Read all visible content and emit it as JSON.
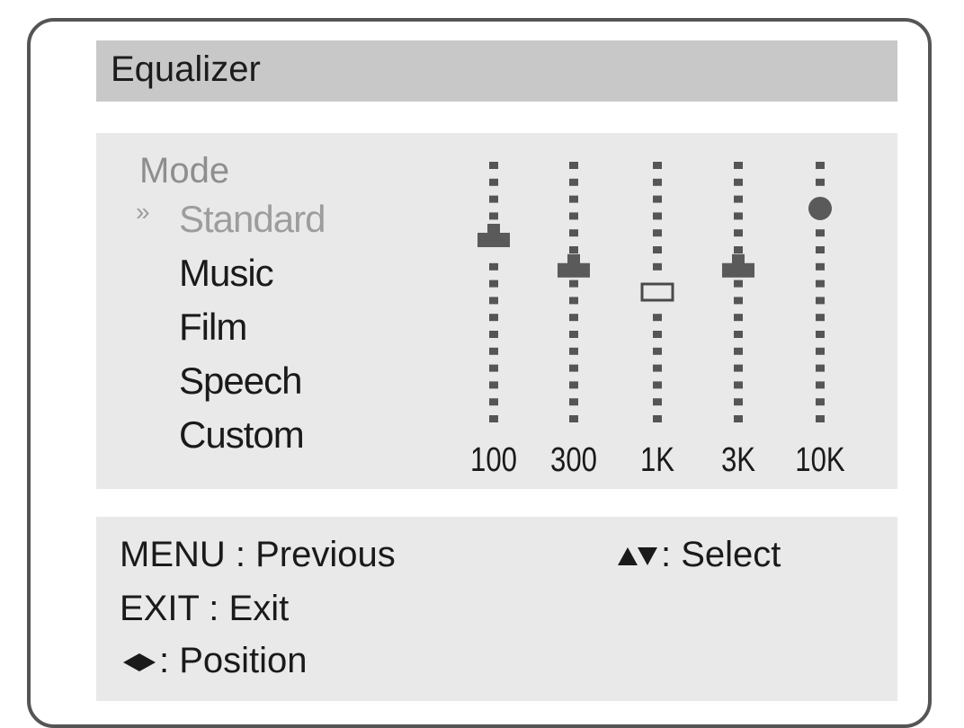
{
  "title": "Equalizer",
  "mode": {
    "heading": "Mode",
    "selected_marker": "»",
    "items": [
      {
        "label": "Standard",
        "selected": true
      },
      {
        "label": "Music",
        "selected": false
      },
      {
        "label": "Film",
        "selected": false
      },
      {
        "label": "Speech",
        "selected": false
      },
      {
        "label": "Custom",
        "selected": false
      }
    ]
  },
  "equalizer": {
    "bands": [
      {
        "label": "100",
        "level": 0.72,
        "handle": "filled"
      },
      {
        "label": "300",
        "level": 0.6,
        "handle": "filled"
      },
      {
        "label": "1K",
        "level": 0.5,
        "handle": "outline"
      },
      {
        "label": "3K",
        "level": 0.6,
        "handle": "filled"
      },
      {
        "label": "10K",
        "level": 0.83,
        "handle": "round"
      }
    ]
  },
  "footer": {
    "previous": "MENU : Previous",
    "exit": "EXIT : Exit",
    "select": ": Select",
    "position": ": Position"
  },
  "colors": {
    "panel": "#e9e9e9",
    "title_bar": "#c8c8c8",
    "selected_text": "#9d9d9d",
    "dots": "#555555"
  }
}
